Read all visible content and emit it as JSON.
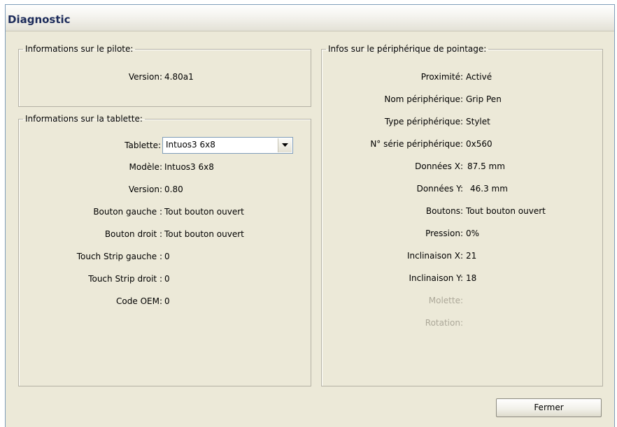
{
  "window": {
    "title": "Diagnostic"
  },
  "driver": {
    "legend": "Informations sur le pilote:",
    "version_label": "Version:",
    "version_value": "4.80a1"
  },
  "tablet": {
    "legend": "Informations sur la tablette:",
    "tablet_label": "Tablette:",
    "tablet_selected": "Intuos3 6x8",
    "model_label": "Modèle:",
    "model_value": "Intuos3 6x8",
    "version_label": "Version:",
    "version_value": "0.80",
    "left_button_label": "Bouton gauche :",
    "left_button_value": "Tout bouton ouvert",
    "right_button_label": "Bouton droit :",
    "right_button_value": "Tout bouton ouvert",
    "touch_left_label": "Touch Strip gauche :",
    "touch_left_value": "0",
    "touch_right_label": "Touch Strip droit :",
    "touch_right_value": "0",
    "oem_label": "Code OEM:",
    "oem_value": "0"
  },
  "pointer": {
    "legend": "Infos sur le périphérique de pointage:",
    "proximity_label": "Proximité:",
    "proximity_value": "Activé",
    "name_label": "Nom périphérique:",
    "name_value": "Grip Pen",
    "type_label": "Type périphérique:",
    "type_value": "Stylet",
    "serial_label": "N° série périphérique:",
    "serial_value": "0x560",
    "x_label": "Données X:",
    "x_value": "87.5 mm",
    "y_label": "Données Y:",
    "y_value": "46.3 mm",
    "buttons_label": "Boutons:",
    "buttons_value": "Tout bouton ouvert",
    "pressure_label": "Pression:",
    "pressure_value": "0%",
    "tilt_x_label": "Inclinaison X:",
    "tilt_x_value": "21",
    "tilt_y_label": "Inclinaison Y:",
    "tilt_y_value": "18",
    "wheel_label": "Molette:",
    "rotation_label": "Rotation:"
  },
  "buttons": {
    "close_label": "Fermer"
  }
}
